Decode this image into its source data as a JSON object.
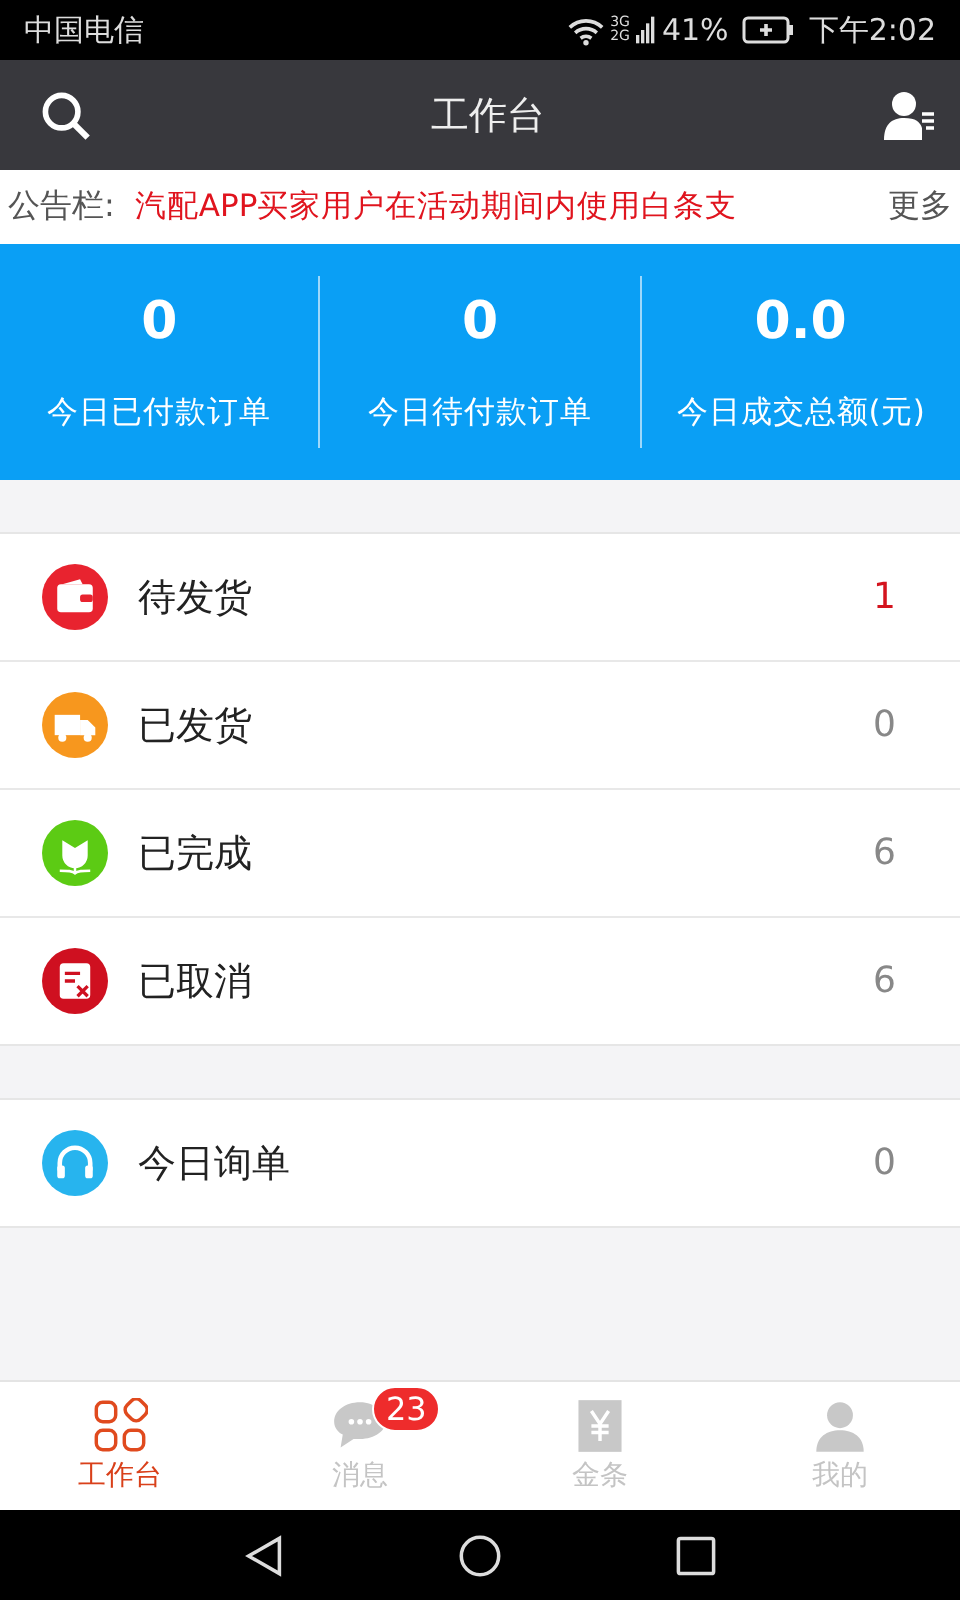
{
  "status_bar": {
    "carrier": "中国电信",
    "network": "3G\n2G",
    "battery": "41%",
    "time": "下午2:02"
  },
  "header": {
    "title": "工作台"
  },
  "notice": {
    "label": "公告栏:",
    "text": "汽配APP买家用户在活动期间内使用白条支",
    "more": "更多"
  },
  "stats": [
    {
      "value": "0",
      "label": "今日已付款订单"
    },
    {
      "value": "0",
      "label": "今日待付款订单"
    },
    {
      "value": "0.0",
      "label": "今日成交总额(元)"
    }
  ],
  "order_groups": [
    [
      {
        "kind": "wallet",
        "color": "#e8232f",
        "label": "待发货",
        "count": "1",
        "highlighted": true
      },
      {
        "kind": "truck",
        "color": "#f7971e",
        "label": "已发货",
        "count": "0",
        "highlighted": false
      },
      {
        "kind": "flower",
        "color": "#5ccb14",
        "label": "已完成",
        "count": "6",
        "highlighted": false
      },
      {
        "kind": "cancel",
        "color": "#cf1020",
        "label": "已取消",
        "count": "6",
        "highlighted": false
      }
    ],
    [
      {
        "kind": "headset",
        "color": "#27b4ee",
        "label": "今日询单",
        "count": "0",
        "highlighted": false
      }
    ]
  ],
  "tabs": [
    {
      "kind": "grid",
      "label": "工作台",
      "selected": true
    },
    {
      "kind": "chat",
      "label": "消息",
      "selected": false,
      "badge": "23"
    },
    {
      "kind": "yen",
      "label": "金条",
      "selected": false
    },
    {
      "kind": "person",
      "label": "我的",
      "selected": false
    }
  ]
}
